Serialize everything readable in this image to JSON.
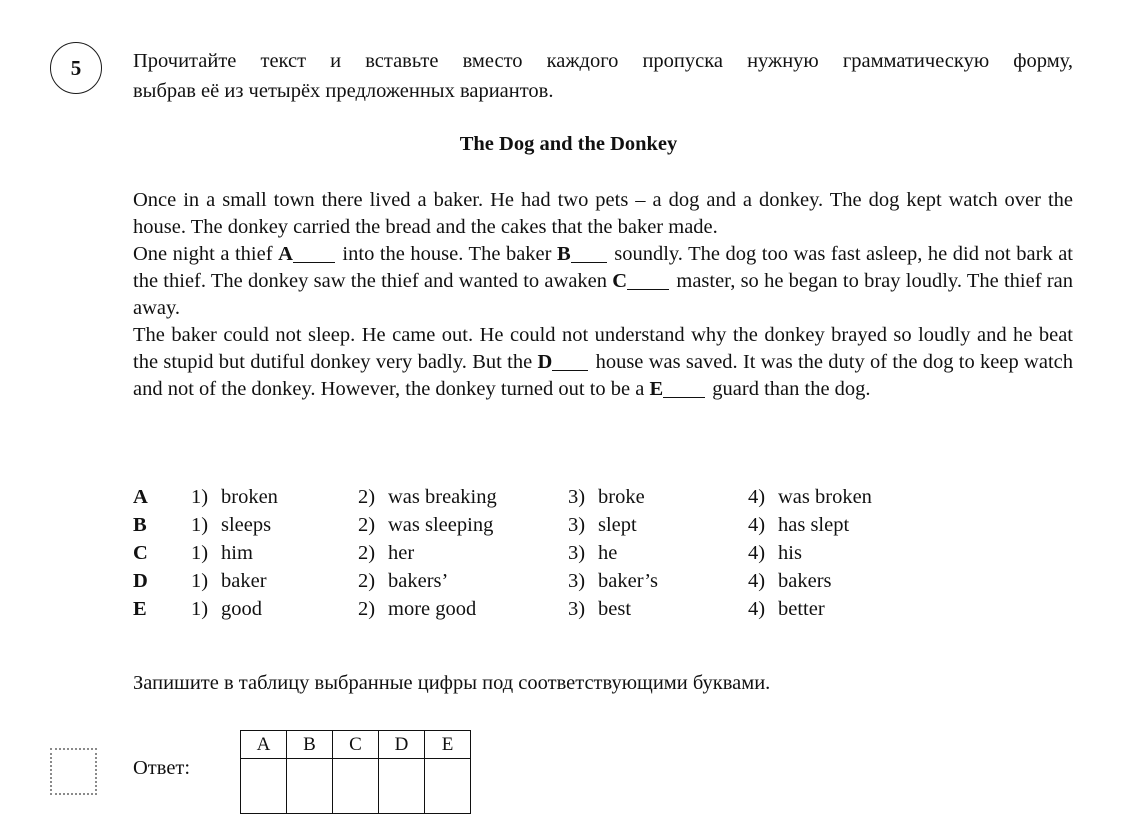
{
  "task": {
    "number": "5",
    "instruction_line1": "Прочитайте текст и вставьте вместо каждого пропуска нужную грамматическую форму,",
    "instruction_line2": "выбрав её из четырёх предложенных вариантов."
  },
  "story": {
    "title": "The Dog and the Donkey",
    "paragraph1": "Once in a small town there lived a baker. He had two pets – a dog and a donkey. The dog kept watch over the house. The donkey carried the bread and the cakes that the baker made.",
    "paragraph2": {
      "part1": "One night a thief ",
      "gapA": "A",
      "part2": " into the house. The baker ",
      "gapB": "B",
      "part3": " soundly. The dog too was fast asleep, he did not bark at the thief. The donkey saw the thief and wanted to awaken ",
      "gapC": "C",
      "part4": " master, so he began to bray loudly. The thief ran away."
    },
    "paragraph3": {
      "part1": "The baker could not sleep. He came out. He could not understand why the donkey brayed so loudly and he beat the stupid but dutiful donkey very badly. But the ",
      "gapD": "D",
      "part2": " house was saved. It was the duty of the dog to keep watch and not of the donkey. However, the donkey turned out to be a ",
      "gapE": "E",
      "part3": " guard than the dog."
    }
  },
  "options": [
    {
      "letter": "A",
      "choices": [
        {
          "num": "1)",
          "text": "broken"
        },
        {
          "num": "2)",
          "text": "was breaking"
        },
        {
          "num": "3)",
          "text": "broke"
        },
        {
          "num": "4)",
          "text": "was broken"
        }
      ]
    },
    {
      "letter": "B",
      "choices": [
        {
          "num": "1)",
          "text": "sleeps"
        },
        {
          "num": "2)",
          "text": "was sleeping"
        },
        {
          "num": "3)",
          "text": "slept"
        },
        {
          "num": "4)",
          "text": "has slept"
        }
      ]
    },
    {
      "letter": "C",
      "choices": [
        {
          "num": "1)",
          "text": "him"
        },
        {
          "num": "2)",
          "text": "her"
        },
        {
          "num": "3)",
          "text": "he"
        },
        {
          "num": "4)",
          "text": "his"
        }
      ]
    },
    {
      "letter": "D",
      "choices": [
        {
          "num": "1)",
          "text": "baker"
        },
        {
          "num": "2)",
          "text": "bakers’"
        },
        {
          "num": "3)",
          "text": "baker’s"
        },
        {
          "num": "4)",
          "text": "bakers"
        }
      ]
    },
    {
      "letter": "E",
      "choices": [
        {
          "num": "1)",
          "text": "good"
        },
        {
          "num": "2)",
          "text": "more good"
        },
        {
          "num": "3)",
          "text": "best"
        },
        {
          "num": "4)",
          "text": "better"
        }
      ]
    }
  ],
  "answer_section": {
    "note": "Запишите в таблицу выбранные цифры под соответствующими буквами.",
    "label": "Ответ:",
    "table_headers": [
      "A",
      "B",
      "C",
      "D",
      "E"
    ],
    "table_values": [
      "",
      "",
      "",
      "",
      ""
    ]
  }
}
